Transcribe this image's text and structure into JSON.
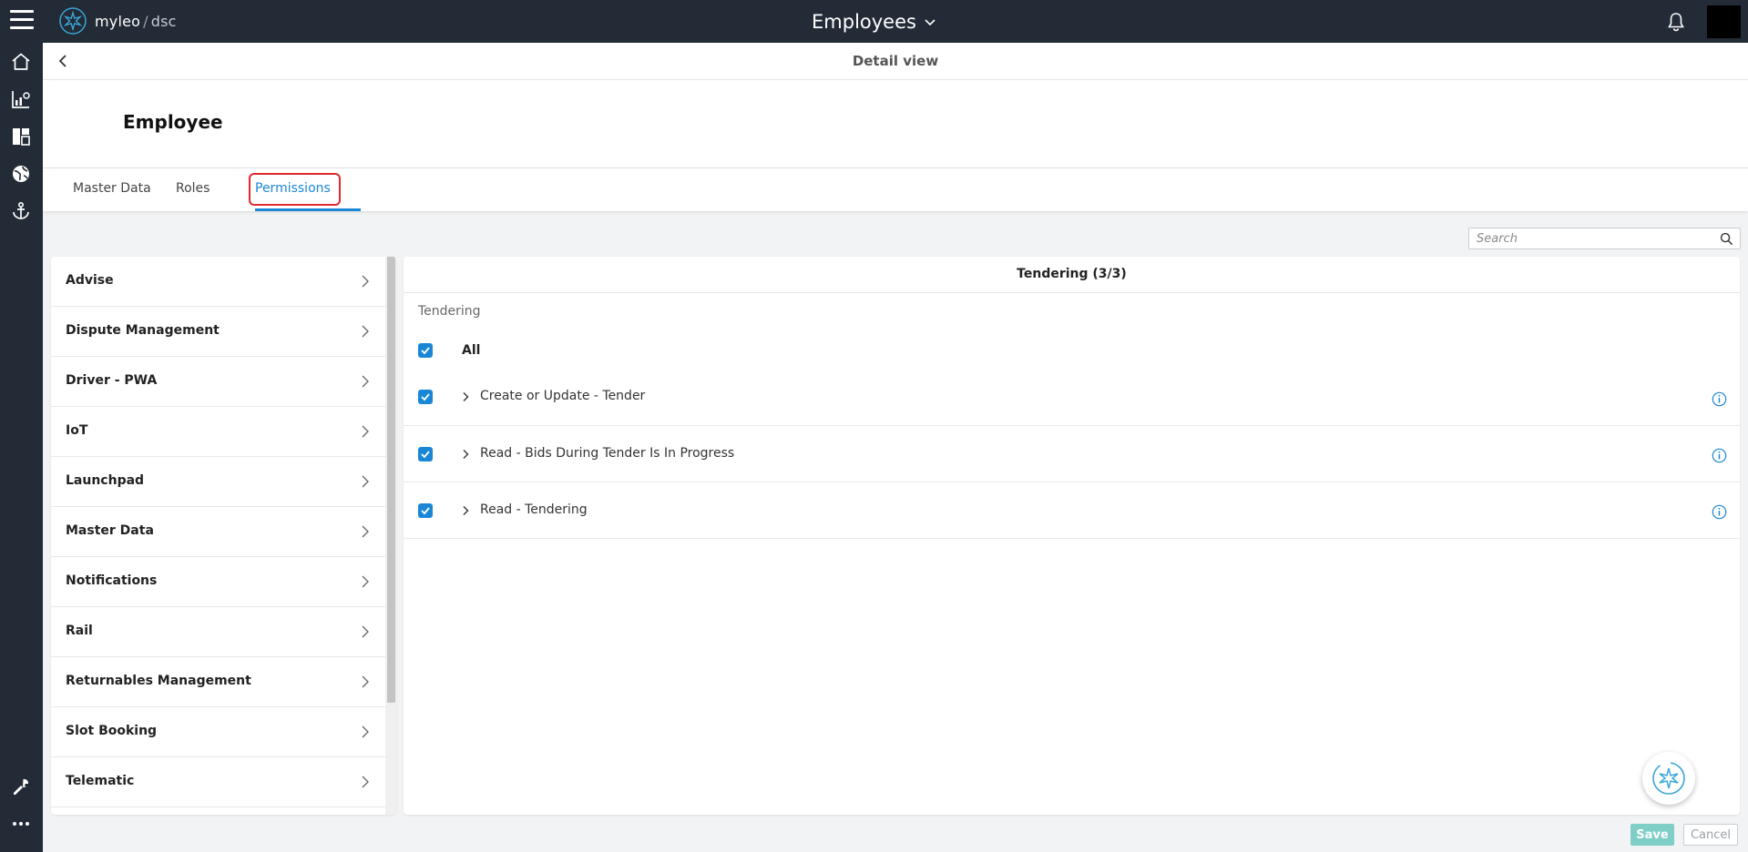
{
  "topbar": {
    "logo_brand": "myleo",
    "logo_separator": "/",
    "logo_product": "dsc",
    "app_title": "Employees"
  },
  "sidebar": {
    "icons": [
      "home-icon",
      "analytics-icon",
      "dashboard-icon",
      "globe-icon",
      "anchor-icon",
      "wrench-icon",
      "more-icon"
    ]
  },
  "detail": {
    "title": "Detail view",
    "entity_title": "Employee"
  },
  "tabs": [
    {
      "label": "Master Data",
      "active": false
    },
    {
      "label": "Roles",
      "active": false
    },
    {
      "label": "Permissions",
      "active": true
    }
  ],
  "search": {
    "placeholder": "Search",
    "value": ""
  },
  "categories": [
    {
      "label": "Advise"
    },
    {
      "label": "Dispute Management"
    },
    {
      "label": "Driver - PWA"
    },
    {
      "label": "IoT"
    },
    {
      "label": "Launchpad"
    },
    {
      "label": "Master Data"
    },
    {
      "label": "Notifications"
    },
    {
      "label": "Rail"
    },
    {
      "label": "Returnables Management"
    },
    {
      "label": "Slot Booking"
    },
    {
      "label": "Telematic"
    }
  ],
  "permissions": {
    "header": "Tendering (3/3)",
    "group_label": "Tendering",
    "all_label": "All",
    "all_checked": true,
    "rows": [
      {
        "label": "Create or Update - Tender",
        "checked": true
      },
      {
        "label": "Read - Bids During Tender Is In Progress",
        "checked": true
      },
      {
        "label": "Read - Tendering",
        "checked": true
      }
    ]
  },
  "footer": {
    "save_label": "Save",
    "cancel_label": "Cancel"
  },
  "colors": {
    "topbar_bg": "#222b36",
    "accent": "#1a87d6",
    "save_bg": "#7fcfc7",
    "highlight": "#e0282e"
  }
}
